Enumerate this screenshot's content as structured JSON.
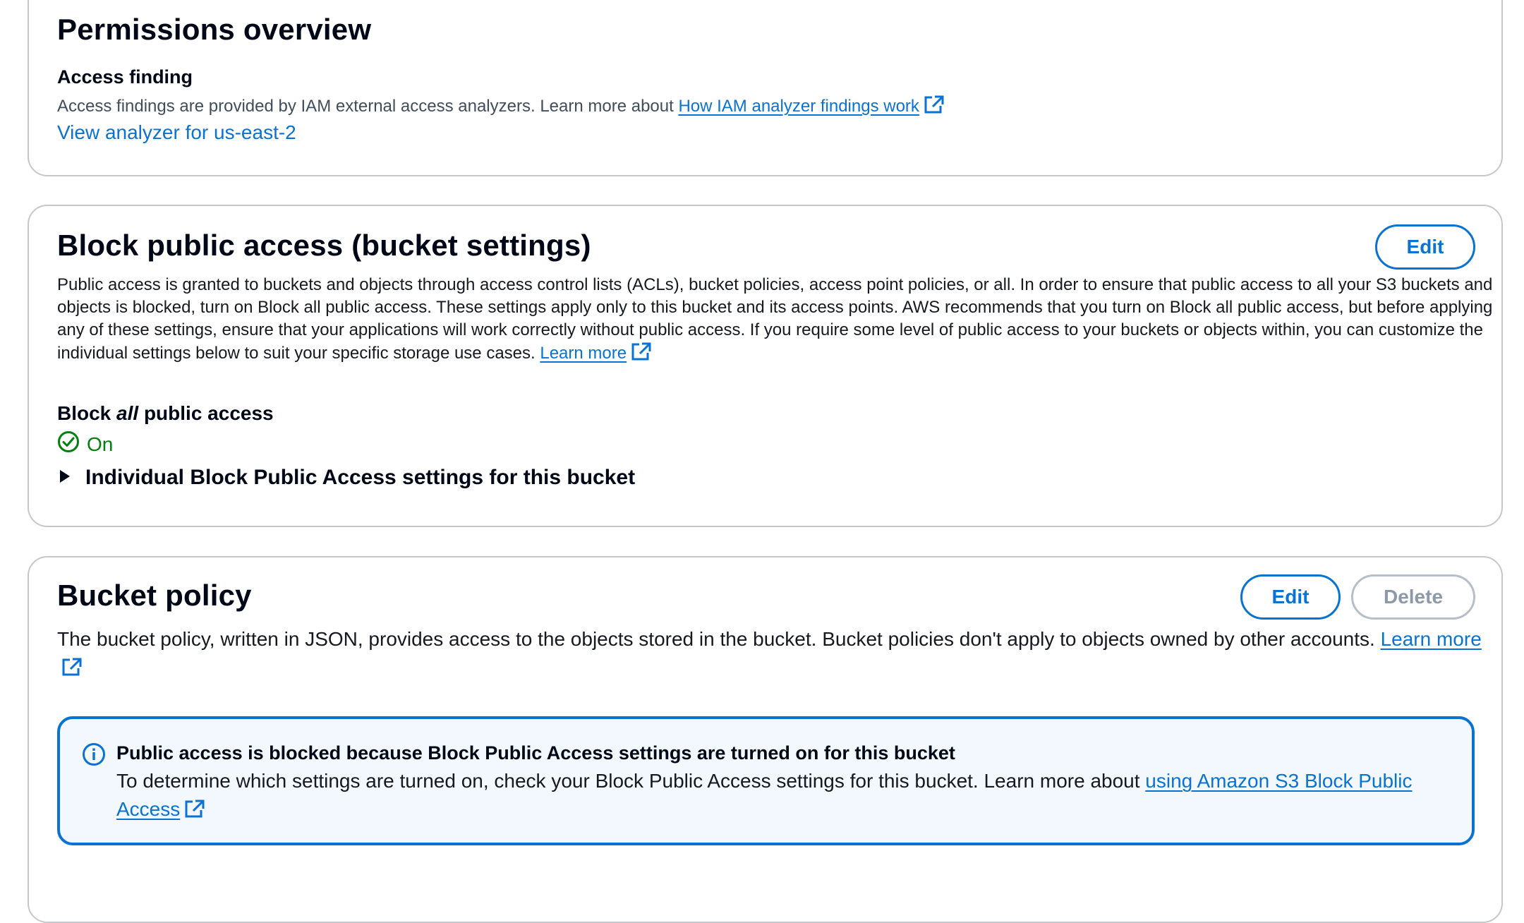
{
  "permissions": {
    "title": "Permissions overview",
    "access_finding_heading": "Access finding",
    "access_finding_text": "Access findings are provided by IAM external access analyzers. Learn more about ",
    "access_finding_link": "How IAM analyzer findings work",
    "view_analyzer_link": "View analyzer for us-east-2"
  },
  "block_public_access": {
    "title": "Block public access (bucket settings)",
    "edit_label": "Edit",
    "description": "Public access is granted to buckets and objects through access control lists (ACLs), bucket policies, access point policies, or all. In order to ensure that public access to all your S3 buckets and objects is blocked, turn on Block all public access. These settings apply only to this bucket and its access points. AWS recommends that you turn on Block all public access, but before applying any of these settings, ensure that your applications will work correctly without public access. If you require some level of public access to your buckets or objects within, you can customize the individual settings below to suit your specific storage use cases. ",
    "learn_more_link": "Learn more",
    "block_all_prefix": "Block ",
    "block_all_emphasis": "all",
    "block_all_suffix": " public access",
    "status": "On",
    "expander_label": "Individual Block Public Access settings for this bucket"
  },
  "bucket_policy": {
    "title": "Bucket policy",
    "edit_label": "Edit",
    "delete_label": "Delete",
    "description": "The bucket policy, written in JSON, provides access to the objects stored in the bucket. Bucket policies don't apply to objects owned by other accounts. ",
    "learn_more_link": "Learn more",
    "alert": {
      "title": "Public access is blocked because Block Public Access settings are turned on for this bucket",
      "text": "To determine which settings are turned on, check your Block Public Access settings for this bucket. Learn more about ",
      "link": "using Amazon S3 Block Public Access"
    }
  },
  "colors": {
    "link": "#0972d3",
    "success": "#037f0c",
    "border": "#c6c6cd",
    "info_bg": "#f2f8fd",
    "disabled": "#8d99a8"
  },
  "icons": [
    "external-link-icon",
    "status-success-icon",
    "caret-right-icon",
    "info-icon"
  ]
}
